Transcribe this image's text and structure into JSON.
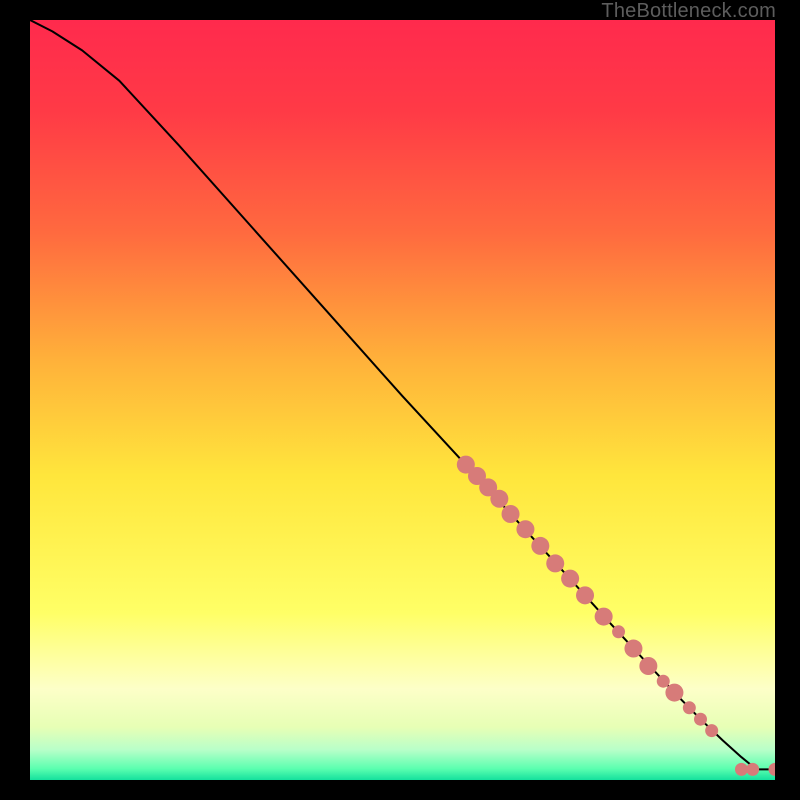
{
  "watermark": "TheBottleneck.com",
  "chart_data": {
    "type": "line",
    "title": "",
    "xlabel": "",
    "ylabel": "",
    "xlim": [
      0,
      100
    ],
    "ylim": [
      0,
      100
    ],
    "grid": false,
    "legend": false,
    "background_gradient": {
      "stops": [
        {
          "offset": 0.0,
          "color": "#ff2a4d"
        },
        {
          "offset": 0.12,
          "color": "#ff3a46"
        },
        {
          "offset": 0.28,
          "color": "#ff6a3f"
        },
        {
          "offset": 0.45,
          "color": "#ffb23a"
        },
        {
          "offset": 0.6,
          "color": "#ffe63c"
        },
        {
          "offset": 0.78,
          "color": "#ffff66"
        },
        {
          "offset": 0.88,
          "color": "#fdffc8"
        },
        {
          "offset": 0.93,
          "color": "#e7ffb5"
        },
        {
          "offset": 0.96,
          "color": "#b9ffc9"
        },
        {
          "offset": 0.985,
          "color": "#5cffb0"
        },
        {
          "offset": 1.0,
          "color": "#14e09d"
        }
      ]
    },
    "series": [
      {
        "name": "bottleneck-curve",
        "color": "#000000",
        "x": [
          0,
          3,
          7,
          12,
          20,
          30,
          40,
          50,
          58,
          65,
          72,
          78,
          83,
          87,
          90,
          93,
          95.5,
          97.5,
          100
        ],
        "y": [
          100,
          98.5,
          96,
          92,
          83.5,
          72.5,
          61.5,
          50.5,
          42,
          34.5,
          27,
          20.5,
          15.2,
          11,
          8,
          5.2,
          3,
          1.4,
          1.4
        ]
      }
    ],
    "markers": {
      "name": "data-points",
      "color": "#d77b79",
      "radius_large": 9,
      "radius_small": 6.5,
      "points": [
        {
          "x": 58.5,
          "y": 41.5,
          "r": "large"
        },
        {
          "x": 60.0,
          "y": 40.0,
          "r": "large"
        },
        {
          "x": 61.5,
          "y": 38.5,
          "r": "large"
        },
        {
          "x": 63.0,
          "y": 37.0,
          "r": "large"
        },
        {
          "x": 64.5,
          "y": 35.0,
          "r": "large"
        },
        {
          "x": 66.5,
          "y": 33.0,
          "r": "large"
        },
        {
          "x": 68.5,
          "y": 30.8,
          "r": "large"
        },
        {
          "x": 70.5,
          "y": 28.5,
          "r": "large"
        },
        {
          "x": 72.5,
          "y": 26.5,
          "r": "large"
        },
        {
          "x": 74.5,
          "y": 24.3,
          "r": "large"
        },
        {
          "x": 77.0,
          "y": 21.5,
          "r": "large"
        },
        {
          "x": 79.0,
          "y": 19.5,
          "r": "small"
        },
        {
          "x": 81.0,
          "y": 17.3,
          "r": "large"
        },
        {
          "x": 83.0,
          "y": 15.0,
          "r": "large"
        },
        {
          "x": 85.0,
          "y": 13.0,
          "r": "small"
        },
        {
          "x": 86.5,
          "y": 11.5,
          "r": "large"
        },
        {
          "x": 88.5,
          "y": 9.5,
          "r": "small"
        },
        {
          "x": 90.0,
          "y": 8.0,
          "r": "small"
        },
        {
          "x": 91.5,
          "y": 6.5,
          "r": "small"
        },
        {
          "x": 95.5,
          "y": 1.4,
          "r": "small"
        },
        {
          "x": 97.0,
          "y": 1.4,
          "r": "small"
        },
        {
          "x": 100.0,
          "y": 1.4,
          "r": "small"
        }
      ]
    }
  }
}
